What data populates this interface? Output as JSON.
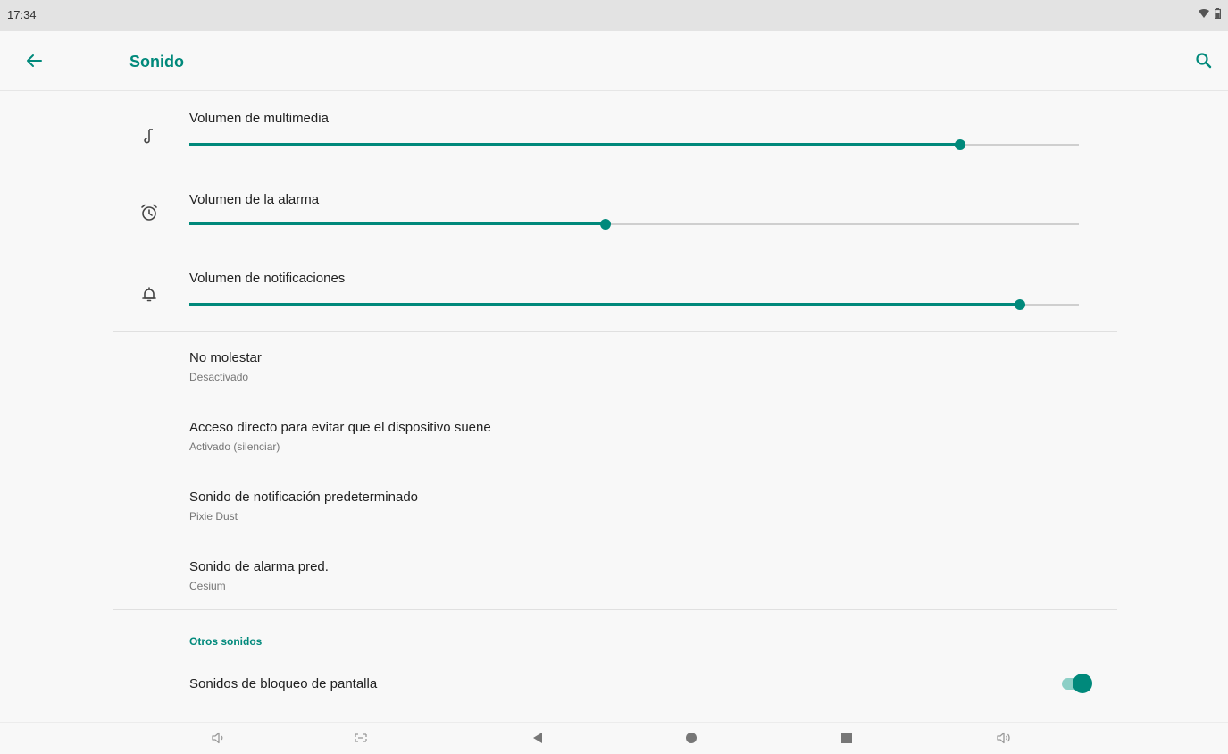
{
  "status_bar": {
    "time": "17:34"
  },
  "app_bar": {
    "title": "Sonido"
  },
  "volumes": [
    {
      "label": "Volumen de multimedia",
      "level": 0.866
    },
    {
      "label": "Volumen de la alarma",
      "level": 0.468
    },
    {
      "label": "Volumen de notificaciones",
      "level": 0.934
    }
  ],
  "prefs": [
    {
      "title": "No molestar",
      "summary": "Desactivado"
    },
    {
      "title": "Acceso directo para evitar que el dispositivo suene",
      "summary": "Activado (silenciar)"
    },
    {
      "title": "Sonido de notificación predeterminado",
      "summary": "Pixie Dust"
    },
    {
      "title": "Sonido de alarma pred.",
      "summary": "Cesium"
    }
  ],
  "other_sounds": {
    "header": "Otros sonidos",
    "lock_sounds": {
      "title": "Sonidos de bloqueo de pantalla",
      "enabled": true
    }
  },
  "colors": {
    "accent": "#00897b",
    "track_off": "#cfcfcf",
    "switch_track_on": "#8ccfc6"
  },
  "icons": {
    "volumes": [
      "music-note-icon",
      "alarm-clock-icon",
      "bell-icon"
    ],
    "nav": [
      "volume-down-icon",
      "screenshot-icon",
      "back-icon",
      "home-icon",
      "recents-icon",
      "volume-up-icon"
    ]
  }
}
